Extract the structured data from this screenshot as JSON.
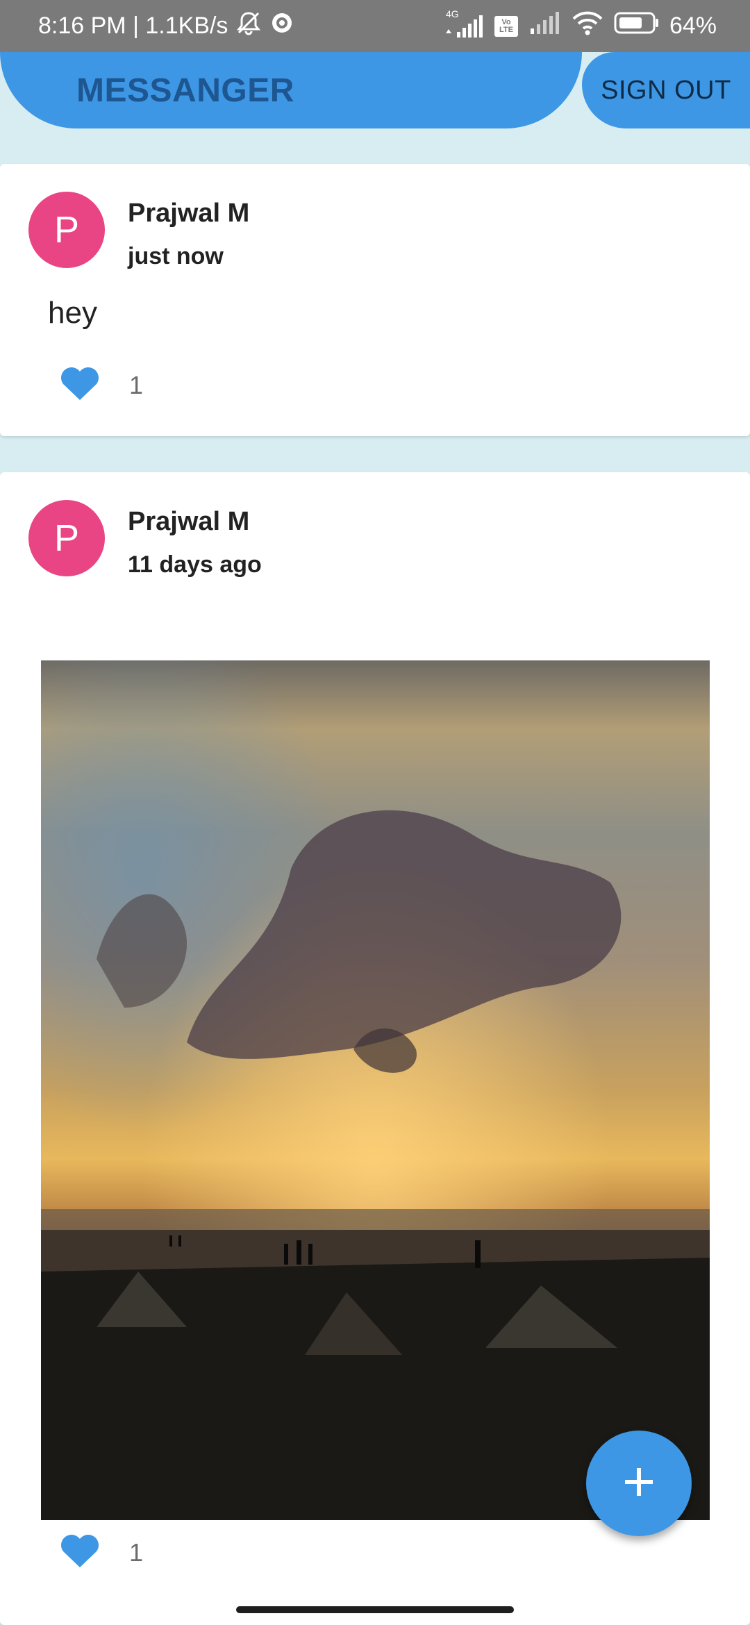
{
  "status_bar": {
    "left_text": "8:16 PM | 1.1KB/s",
    "network_tag": "4G",
    "volte_tag": "Vo LTE",
    "battery_text": "64%",
    "icons": [
      "mute-bell-icon",
      "settings-gear-icon",
      "signal-4g-icon",
      "volte-icon",
      "signal-icon",
      "wifi-icon",
      "battery-icon"
    ]
  },
  "app_bar": {
    "title": "MESSANGER",
    "sign_out_label": "SIGN OUT",
    "color": "#3D97E5"
  },
  "posts": [
    {
      "avatar_letter": "P",
      "author": "Prajwal M",
      "time": "just now",
      "text": "hey",
      "likes": "1"
    },
    {
      "avatar_letter": "P",
      "author": "Prajwal M",
      "time": "11 days ago",
      "image": "sunset-beach-photo",
      "likes": "1"
    }
  ],
  "fab": {
    "icon": "plus-icon"
  },
  "colors": {
    "accent": "#3D97E5",
    "avatar": "#E94584",
    "background": "#D7EDF2"
  }
}
